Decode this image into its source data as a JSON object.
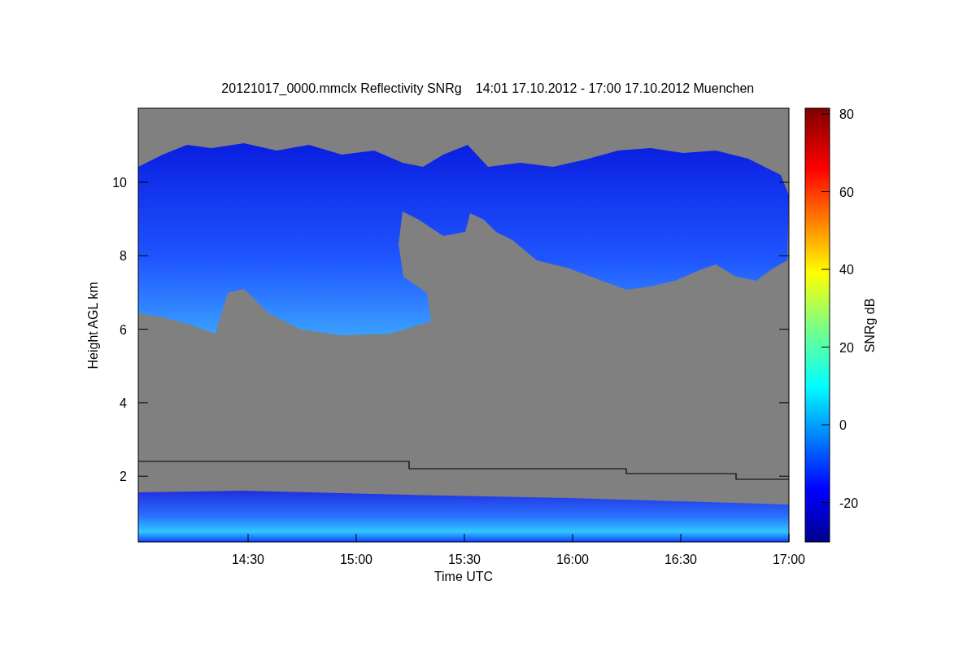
{
  "title": {
    "file": "20121017_0000.mmclx Reflectivity SNRg",
    "period": "14:01 17.10.2012 - 17:00 17.10.2012 Muenchen"
  },
  "x_axis": {
    "label": "Time UTC",
    "ticks": [
      "14:30",
      "15:00",
      "15:30",
      "16:00",
      "16:30",
      "17:00"
    ]
  },
  "y_axis": {
    "label": "Height AGL km",
    "ticks": [
      "10",
      "8",
      "6",
      "4",
      "2"
    ]
  },
  "colorbar": {
    "label": "SNRg dB",
    "ticks": [
      "80",
      "60",
      "40",
      "20",
      "0",
      "-20"
    ]
  }
}
